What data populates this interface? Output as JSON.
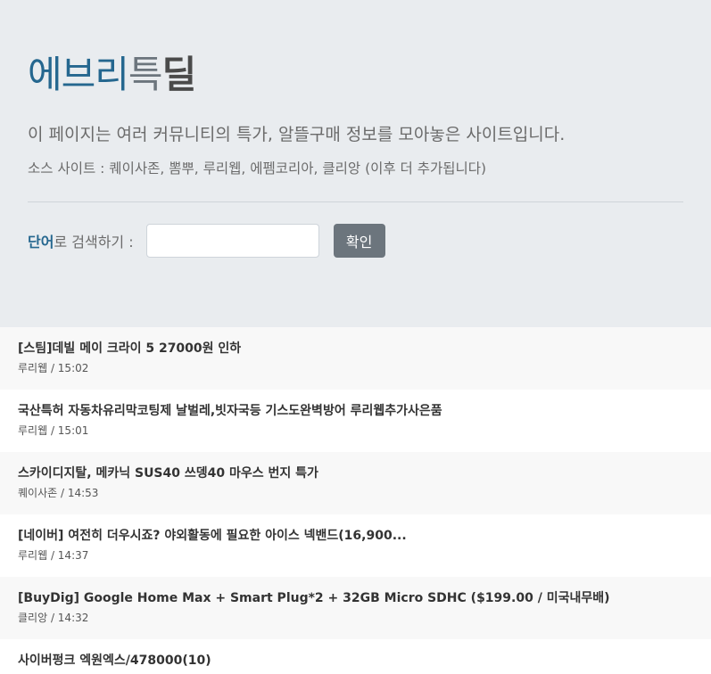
{
  "header": {
    "title_part1": "에브리",
    "title_part2": "특",
    "title_part3": "딜",
    "lead": "이 페이지는 여러 커뮤니티의 특가, 알뜰구매 정보를 모아놓은 사이트입니다.",
    "sources": "소스 사이트 : 퀘이사존, 뽐뿌, 루리웹, 에펨코리아, 클리앙 (이후 더 추가됩니다)"
  },
  "search": {
    "label_keyword": "단어",
    "label_rest": "로 검색하기 :",
    "input_value": "",
    "button_label": "확인"
  },
  "deals": [
    {
      "title": "[스팀]데빌 메이 크라이 5 27000원 인하",
      "source": "루리웹",
      "time": "15:02"
    },
    {
      "title": "국산특허 자동차유리막코팅제 날벌레,빗자국등 기스도완벽방어 루리웹추가사은품",
      "source": "루리웹",
      "time": "15:01"
    },
    {
      "title": "스카이디지탈, 메카닉 SUS40 쓰뎅40 마우스 번지 특가",
      "source": "퀘이사존",
      "time": "14:53"
    },
    {
      "title": "[네이버] 여전히 더우시죠? 야외활동에 필요한 아이스 넥밴드(16,900...",
      "source": "루리웹",
      "time": "14:37"
    },
    {
      "title": "[BuyDig] Google Home Max + Smart Plug*2 + 32GB Micro SDHC ($199.00 / 미국내무배)",
      "source": "클리앙",
      "time": "14:32"
    },
    {
      "title": "사이버펑크 엑원엑스/478000(10)",
      "source": "",
      "time": ""
    }
  ]
}
